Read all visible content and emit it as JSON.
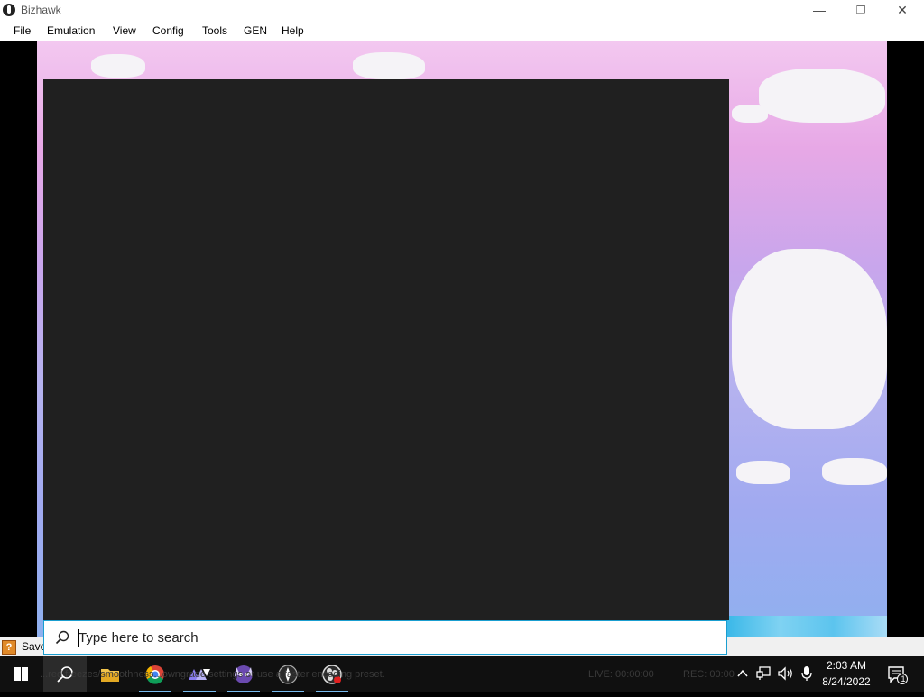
{
  "window": {
    "title": "Bizhawk",
    "icon": "bizhawk-app-icon"
  },
  "controls": {
    "minimize": "—",
    "restore": "❐",
    "close": "✕"
  },
  "menu": {
    "items": [
      "File",
      "Emulation",
      "View",
      "Config",
      "Tools",
      "GEN",
      "Help"
    ]
  },
  "status": {
    "text": "Save"
  },
  "search": {
    "placeholder": "Type here to search"
  },
  "taskbar": {
    "ghost_notice": "...red freezes/smoothness...owngrade settings or use a faster encoding preset.",
    "live": "LIVE: 00:00:00",
    "rec": "REC: 00:00",
    "time": "2:03 AM",
    "date": "8/24/2022",
    "notifications": "1",
    "pinned": [
      "start-icon",
      "search-icon",
      "file-explorer-icon",
      "chrome-icon",
      "app-icon",
      "game-icon",
      "bizhawk-icon",
      "obs-icon"
    ]
  },
  "colors": {
    "accent": "#1a9ed0",
    "taskbar": "#101010",
    "panel": "#202020"
  }
}
